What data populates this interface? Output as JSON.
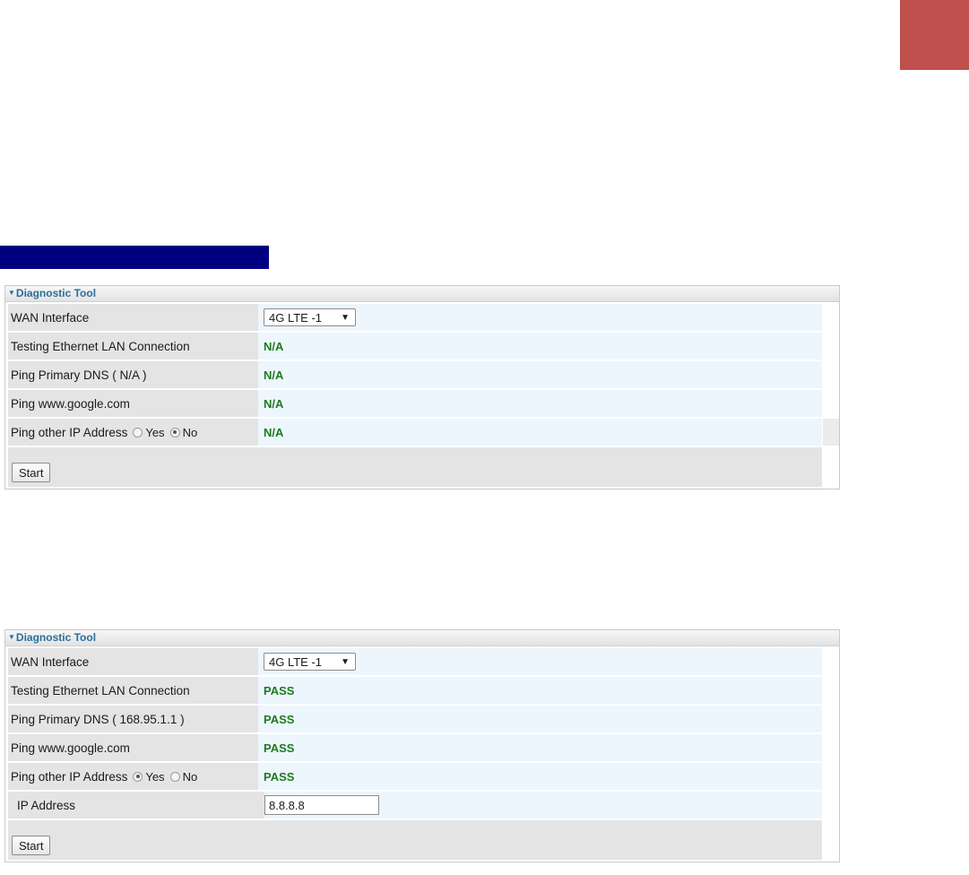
{
  "colors": {
    "corner_block": "#c0504d",
    "blue_bar": "#000080",
    "header_text": "#2a6f9a",
    "status_text": "#1f7a1f"
  },
  "panel1": {
    "title": "Diagnostic Tool",
    "wan_label": "WAN Interface",
    "wan_value": "4G LTE -1",
    "lan_label": "Testing Ethernet LAN Connection",
    "lan_status": "N/A",
    "dns_label": "Ping Primary DNS ( N/A )",
    "dns_status": "N/A",
    "google_label": "Ping www.google.com",
    "google_status": "N/A",
    "other_label": "Ping other IP Address",
    "yes_label": "Yes",
    "no_label": "No",
    "other_selected": "No",
    "other_status": "N/A",
    "start_label": "Start"
  },
  "panel2": {
    "title": "Diagnostic Tool",
    "wan_label": "WAN Interface",
    "wan_value": "4G LTE -1",
    "lan_label": "Testing Ethernet LAN Connection",
    "lan_status": "PASS",
    "dns_label": "Ping Primary DNS ( 168.95.1.1 )",
    "dns_status": "PASS",
    "google_label": "Ping www.google.com",
    "google_status": "PASS",
    "other_label": "Ping other IP Address",
    "yes_label": "Yes",
    "no_label": "No",
    "other_selected": "Yes",
    "other_status": "PASS",
    "ip_label": "IP Address",
    "ip_value": "8.8.8.8",
    "start_label": "Start"
  }
}
